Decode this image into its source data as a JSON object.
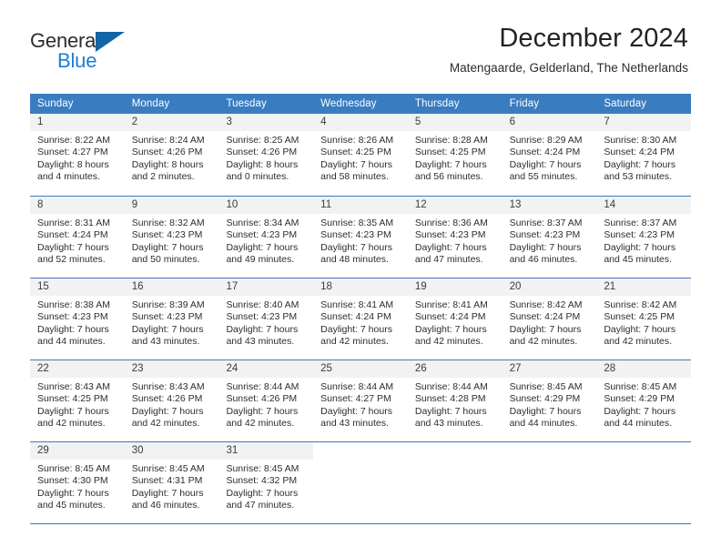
{
  "brand": {
    "name_part1": "General",
    "name_part2": "Blue",
    "triangle_color": "#1464a5",
    "blue_color": "#1b7fd4"
  },
  "header": {
    "title": "December 2024",
    "subtitle": "Matengaarde, Gelderland, The Netherlands"
  },
  "theme": {
    "header_blue": "#3a7cc0",
    "day_band_gray": "#f2f2f2",
    "text_color": "#2d2d2d"
  },
  "calendar": {
    "weekdays": [
      "Sunday",
      "Monday",
      "Tuesday",
      "Wednesday",
      "Thursday",
      "Friday",
      "Saturday"
    ],
    "weeks": [
      [
        {
          "day": "1",
          "sunrise": "Sunrise: 8:22 AM",
          "sunset": "Sunset: 4:27 PM",
          "daylight_1": "Daylight: 8 hours",
          "daylight_2": "and 4 minutes."
        },
        {
          "day": "2",
          "sunrise": "Sunrise: 8:24 AM",
          "sunset": "Sunset: 4:26 PM",
          "daylight_1": "Daylight: 8 hours",
          "daylight_2": "and 2 minutes."
        },
        {
          "day": "3",
          "sunrise": "Sunrise: 8:25 AM",
          "sunset": "Sunset: 4:26 PM",
          "daylight_1": "Daylight: 8 hours",
          "daylight_2": "and 0 minutes."
        },
        {
          "day": "4",
          "sunrise": "Sunrise: 8:26 AM",
          "sunset": "Sunset: 4:25 PM",
          "daylight_1": "Daylight: 7 hours",
          "daylight_2": "and 58 minutes."
        },
        {
          "day": "5",
          "sunrise": "Sunrise: 8:28 AM",
          "sunset": "Sunset: 4:25 PM",
          "daylight_1": "Daylight: 7 hours",
          "daylight_2": "and 56 minutes."
        },
        {
          "day": "6",
          "sunrise": "Sunrise: 8:29 AM",
          "sunset": "Sunset: 4:24 PM",
          "daylight_1": "Daylight: 7 hours",
          "daylight_2": "and 55 minutes."
        },
        {
          "day": "7",
          "sunrise": "Sunrise: 8:30 AM",
          "sunset": "Sunset: 4:24 PM",
          "daylight_1": "Daylight: 7 hours",
          "daylight_2": "and 53 minutes."
        }
      ],
      [
        {
          "day": "8",
          "sunrise": "Sunrise: 8:31 AM",
          "sunset": "Sunset: 4:24 PM",
          "daylight_1": "Daylight: 7 hours",
          "daylight_2": "and 52 minutes."
        },
        {
          "day": "9",
          "sunrise": "Sunrise: 8:32 AM",
          "sunset": "Sunset: 4:23 PM",
          "daylight_1": "Daylight: 7 hours",
          "daylight_2": "and 50 minutes."
        },
        {
          "day": "10",
          "sunrise": "Sunrise: 8:34 AM",
          "sunset": "Sunset: 4:23 PM",
          "daylight_1": "Daylight: 7 hours",
          "daylight_2": "and 49 minutes."
        },
        {
          "day": "11",
          "sunrise": "Sunrise: 8:35 AM",
          "sunset": "Sunset: 4:23 PM",
          "daylight_1": "Daylight: 7 hours",
          "daylight_2": "and 48 minutes."
        },
        {
          "day": "12",
          "sunrise": "Sunrise: 8:36 AM",
          "sunset": "Sunset: 4:23 PM",
          "daylight_1": "Daylight: 7 hours",
          "daylight_2": "and 47 minutes."
        },
        {
          "day": "13",
          "sunrise": "Sunrise: 8:37 AM",
          "sunset": "Sunset: 4:23 PM",
          "daylight_1": "Daylight: 7 hours",
          "daylight_2": "and 46 minutes."
        },
        {
          "day": "14",
          "sunrise": "Sunrise: 8:37 AM",
          "sunset": "Sunset: 4:23 PM",
          "daylight_1": "Daylight: 7 hours",
          "daylight_2": "and 45 minutes."
        }
      ],
      [
        {
          "day": "15",
          "sunrise": "Sunrise: 8:38 AM",
          "sunset": "Sunset: 4:23 PM",
          "daylight_1": "Daylight: 7 hours",
          "daylight_2": "and 44 minutes."
        },
        {
          "day": "16",
          "sunrise": "Sunrise: 8:39 AM",
          "sunset": "Sunset: 4:23 PM",
          "daylight_1": "Daylight: 7 hours",
          "daylight_2": "and 43 minutes."
        },
        {
          "day": "17",
          "sunrise": "Sunrise: 8:40 AM",
          "sunset": "Sunset: 4:23 PM",
          "daylight_1": "Daylight: 7 hours",
          "daylight_2": "and 43 minutes."
        },
        {
          "day": "18",
          "sunrise": "Sunrise: 8:41 AM",
          "sunset": "Sunset: 4:24 PM",
          "daylight_1": "Daylight: 7 hours",
          "daylight_2": "and 42 minutes."
        },
        {
          "day": "19",
          "sunrise": "Sunrise: 8:41 AM",
          "sunset": "Sunset: 4:24 PM",
          "daylight_1": "Daylight: 7 hours",
          "daylight_2": "and 42 minutes."
        },
        {
          "day": "20",
          "sunrise": "Sunrise: 8:42 AM",
          "sunset": "Sunset: 4:24 PM",
          "daylight_1": "Daylight: 7 hours",
          "daylight_2": "and 42 minutes."
        },
        {
          "day": "21",
          "sunrise": "Sunrise: 8:42 AM",
          "sunset": "Sunset: 4:25 PM",
          "daylight_1": "Daylight: 7 hours",
          "daylight_2": "and 42 minutes."
        }
      ],
      [
        {
          "day": "22",
          "sunrise": "Sunrise: 8:43 AM",
          "sunset": "Sunset: 4:25 PM",
          "daylight_1": "Daylight: 7 hours",
          "daylight_2": "and 42 minutes."
        },
        {
          "day": "23",
          "sunrise": "Sunrise: 8:43 AM",
          "sunset": "Sunset: 4:26 PM",
          "daylight_1": "Daylight: 7 hours",
          "daylight_2": "and 42 minutes."
        },
        {
          "day": "24",
          "sunrise": "Sunrise: 8:44 AM",
          "sunset": "Sunset: 4:26 PM",
          "daylight_1": "Daylight: 7 hours",
          "daylight_2": "and 42 minutes."
        },
        {
          "day": "25",
          "sunrise": "Sunrise: 8:44 AM",
          "sunset": "Sunset: 4:27 PM",
          "daylight_1": "Daylight: 7 hours",
          "daylight_2": "and 43 minutes."
        },
        {
          "day": "26",
          "sunrise": "Sunrise: 8:44 AM",
          "sunset": "Sunset: 4:28 PM",
          "daylight_1": "Daylight: 7 hours",
          "daylight_2": "and 43 minutes."
        },
        {
          "day": "27",
          "sunrise": "Sunrise: 8:45 AM",
          "sunset": "Sunset: 4:29 PM",
          "daylight_1": "Daylight: 7 hours",
          "daylight_2": "and 44 minutes."
        },
        {
          "day": "28",
          "sunrise": "Sunrise: 8:45 AM",
          "sunset": "Sunset: 4:29 PM",
          "daylight_1": "Daylight: 7 hours",
          "daylight_2": "and 44 minutes."
        }
      ],
      [
        {
          "day": "29",
          "sunrise": "Sunrise: 8:45 AM",
          "sunset": "Sunset: 4:30 PM",
          "daylight_1": "Daylight: 7 hours",
          "daylight_2": "and 45 minutes."
        },
        {
          "day": "30",
          "sunrise": "Sunrise: 8:45 AM",
          "sunset": "Sunset: 4:31 PM",
          "daylight_1": "Daylight: 7 hours",
          "daylight_2": "and 46 minutes."
        },
        {
          "day": "31",
          "sunrise": "Sunrise: 8:45 AM",
          "sunset": "Sunset: 4:32 PM",
          "daylight_1": "Daylight: 7 hours",
          "daylight_2": "and 47 minutes."
        },
        {
          "day": "",
          "sunrise": "",
          "sunset": "",
          "daylight_1": "",
          "daylight_2": ""
        },
        {
          "day": "",
          "sunrise": "",
          "sunset": "",
          "daylight_1": "",
          "daylight_2": ""
        },
        {
          "day": "",
          "sunrise": "",
          "sunset": "",
          "daylight_1": "",
          "daylight_2": ""
        },
        {
          "day": "",
          "sunrise": "",
          "sunset": "",
          "daylight_1": "",
          "daylight_2": ""
        }
      ]
    ]
  }
}
